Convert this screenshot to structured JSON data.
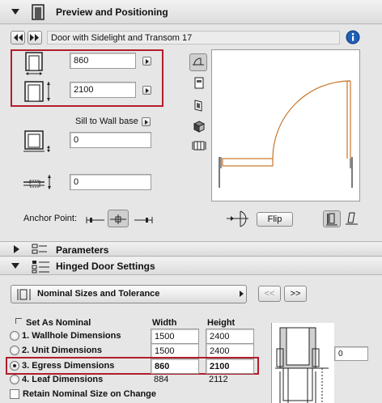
{
  "preview_panel": {
    "title": "Preview and Positioning",
    "object_name": "Door with Sidelight and Transom 17",
    "width_value": "860",
    "height_value": "2100",
    "sill_ref_label": "Sill to Wall base",
    "sill_value": "0",
    "offset_value": "0",
    "anchor_label": "Anchor Point:",
    "flip_label": "Flip"
  },
  "parameters_panel": {
    "title": "Parameters"
  },
  "hinged_panel": {
    "title": "Hinged Door Settings",
    "dropdown_value": "Nominal Sizes and Tolerance",
    "prev_label": "<<",
    "next_label": ">>",
    "set_nominal_label": "Set As Nominal",
    "col_width": "Width",
    "col_height": "Height",
    "rows": [
      {
        "label": "1. Wallhole Dimensions",
        "width": "1500",
        "height": "2400",
        "selected": false
      },
      {
        "label": "2. Unit Dimensions",
        "width": "1500",
        "height": "2400",
        "selected": false
      },
      {
        "label": "3. Egress Dimensions",
        "width": "860",
        "height": "2100",
        "selected": true
      },
      {
        "label": "4. Leaf Dimensions",
        "width": "884",
        "height": "2112",
        "selected": false
      }
    ],
    "retain_label": "Retain Nominal Size on Change",
    "diagram_value": "0"
  },
  "colors": {
    "highlight_border": "#b21d2a",
    "door_swing": "#c8742a",
    "info_blue": "#1f5fb8"
  }
}
